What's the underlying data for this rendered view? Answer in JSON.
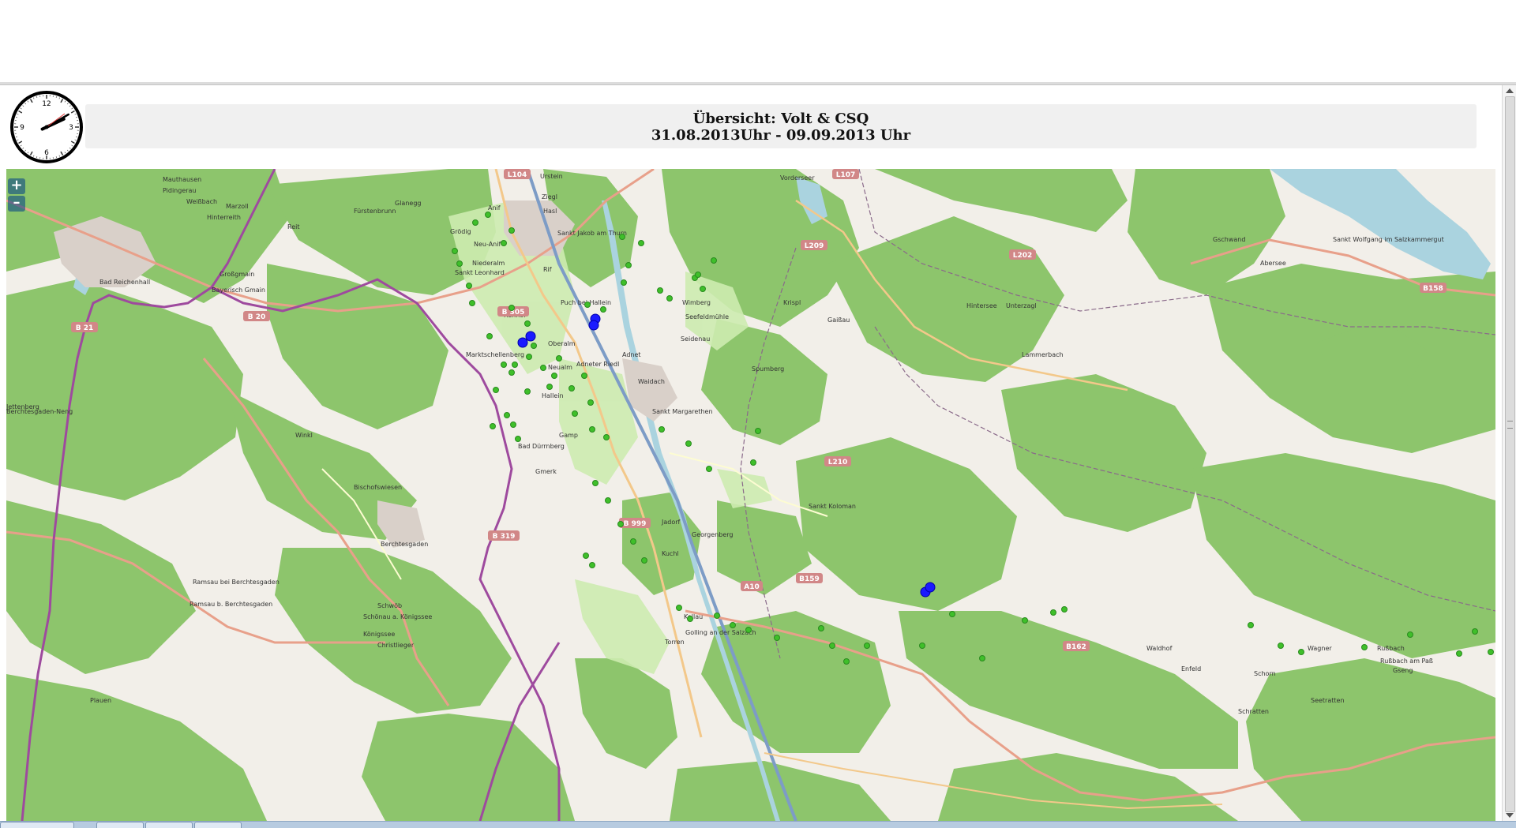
{
  "header": {
    "title": "Übersicht: Volt & CSQ",
    "date_range": "31.08.2013Uhr - 09.09.2013 Uhr"
  },
  "clock": {
    "hour": 2,
    "minute": 10,
    "numerals": [
      "12",
      "3",
      "6",
      "9"
    ]
  },
  "map": {
    "zoom_in": "+",
    "zoom_out": "–",
    "places": [
      "Mauthausen",
      "Pidingerau",
      "Weißbach",
      "Marzoll",
      "Hinterreith",
      "Reit",
      "Fürstenbrunn",
      "Glanegg",
      "Grödig",
      "Neu-Anif",
      "Anif",
      "Ziegl",
      "Hasl",
      "Urstein",
      "Sankt Jakob am Thurn",
      "Niederalm",
      "Sankt Leonhard",
      "Rif",
      "Puch bei Hallein",
      "Bad Reichenhall",
      "Großgmain",
      "Bayerisch Gmain",
      "Rehhof",
      "Oberalm",
      "Neualm",
      "Adneter Riedl",
      "Hallein",
      "Gamp",
      "Bad Dürrnberg",
      "Gmerk",
      "Marktschellenberg",
      "Winkl",
      "Bischofswiesen",
      "Berchtesgaden",
      "Ramsau bei Berchtesgaden",
      "Ramsau b. Berchtesgaden",
      "Schönau a. Königssee",
      "Königssee",
      "Christlieger",
      "Schwöb",
      "Seefeldmühle",
      "Seidenau",
      "Adnet",
      "Waidach",
      "Spumberg",
      "Wimberg",
      "Krispl",
      "Gaißau",
      "Sankt Margarethen",
      "Jadorf",
      "Georgenberg",
      "Kuchl",
      "Kellau",
      "Golling an der Salzach",
      "Torren",
      "Sankt Koloman",
      "Vorderseer",
      "Hintersee",
      "Unterzagl",
      "Lammerbach",
      "Gschwand",
      "Abersee",
      "Sankt Wolfgang im Salzkammergut",
      "Waldhof",
      "Enfeld",
      "Wagner",
      "Schorn",
      "Seetratten",
      "Rußbach",
      "Rußbach am Paß",
      "Gseng",
      "Schratten",
      "Berchtesgaden-Neng",
      "Plauen",
      "Jettenberg"
    ],
    "roads": [
      "B 20",
      "B 21",
      "B 305",
      "B 319",
      "B 999",
      "A10",
      "B159",
      "B162",
      "B158",
      "L209",
      "L202",
      "L210",
      "L107",
      "L104"
    ]
  },
  "colors": {
    "land": "#f2efe9",
    "forest": "#8dc56c",
    "water": "#aad3df",
    "border": "#9e4a9e",
    "road_label": "#d18787",
    "station_marker": "#2a8a1f",
    "cluster_marker": "#1a1aff"
  }
}
